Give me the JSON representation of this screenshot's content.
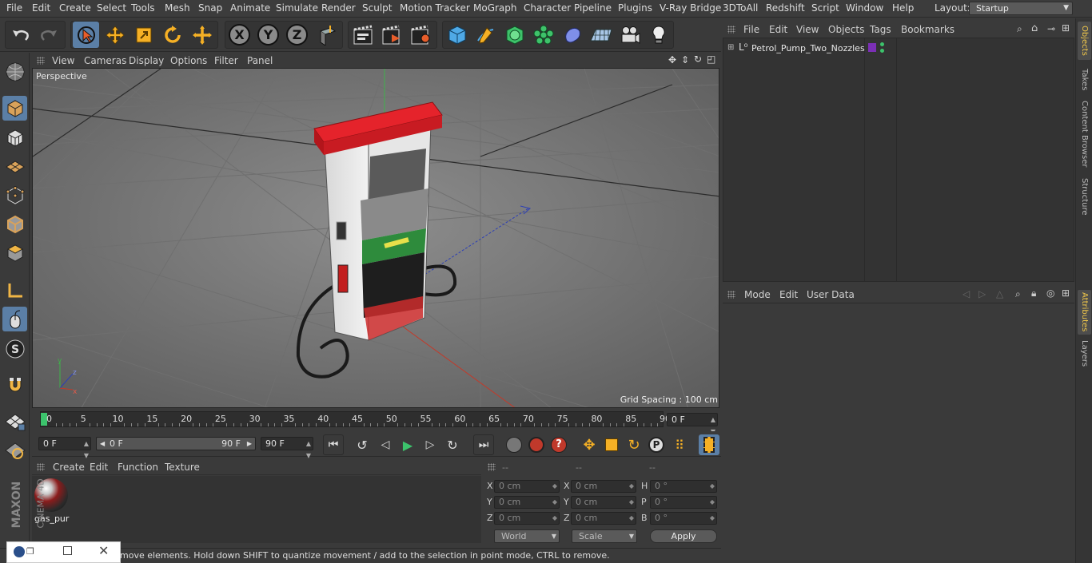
{
  "menu": [
    "File",
    "Edit",
    "Create",
    "Select",
    "Tools",
    "Mesh",
    "Snap",
    "Animate",
    "Simulate",
    "Render",
    "Sculpt",
    "Motion Tracker",
    "MoGraph",
    "Character",
    "Pipeline",
    "Plugins",
    "V-Ray Bridge",
    "3DToAll",
    "Redshift",
    "Script",
    "Window",
    "Help"
  ],
  "layout": {
    "label": "Layout:",
    "value": "Startup"
  },
  "toolbar": {
    "undo": "undo-icon",
    "redo": "redo-icon",
    "x_axis": "X",
    "y_axis": "Y",
    "z_axis": "Z"
  },
  "viewport": {
    "menu": [
      "View",
      "Cameras",
      "Display",
      "Options",
      "Filter",
      "Panel"
    ],
    "camera_label": "Perspective",
    "grid_spacing": "Grid Spacing : 100 cm"
  },
  "timeline": {
    "ticks": [
      "0",
      "5",
      "10",
      "15",
      "20",
      "25",
      "30",
      "35",
      "40",
      "45",
      "50",
      "55",
      "60",
      "65",
      "70",
      "75",
      "80",
      "85",
      "90"
    ],
    "current_frame": "0 F"
  },
  "transport": {
    "start_frame": "0 F",
    "range_start": "0 F",
    "range_end": "90 F",
    "end_frame": "90 F"
  },
  "material_manager": {
    "menu": [
      "Create",
      "Edit",
      "Function",
      "Texture"
    ],
    "material_name": "gas_pur"
  },
  "coordinates": {
    "header": [
      "--",
      "--",
      "--"
    ],
    "rows": [
      {
        "a": "X",
        "av": "0 cm",
        "b": "X",
        "bv": "0 cm",
        "c": "H",
        "cv": "0 °"
      },
      {
        "a": "Y",
        "av": "0 cm",
        "b": "Y",
        "bv": "0 cm",
        "c": "P",
        "cv": "0 °"
      },
      {
        "a": "Z",
        "av": "0 cm",
        "b": "Z",
        "bv": "0 cm",
        "c": "B",
        "cv": "0 °"
      }
    ],
    "space": "World",
    "mode": "Scale",
    "apply": "Apply"
  },
  "status": "move elements. Hold down SHIFT to quantize movement / add to the selection in point mode, CTRL to remove.",
  "object_manager": {
    "menu": [
      "File",
      "Edit",
      "View",
      "Objects",
      "Tags",
      "Bookmarks"
    ],
    "object_name": "Petrol_Pump_Two_Nozzles"
  },
  "attributes": {
    "menu": [
      "Mode",
      "Edit",
      "User Data"
    ]
  },
  "right_tabs": [
    "Objects",
    "Takes",
    "Content Browser",
    "Structure",
    "Attributes",
    "Layers"
  ],
  "brand": {
    "maxon": "MAXON",
    "product": "CINEMA 4D"
  },
  "colors": {
    "accent": "#5b7fa6",
    "playhead": "#3cc36c",
    "tab_active": "#f0c74a",
    "pump_red": "#d81f26"
  }
}
